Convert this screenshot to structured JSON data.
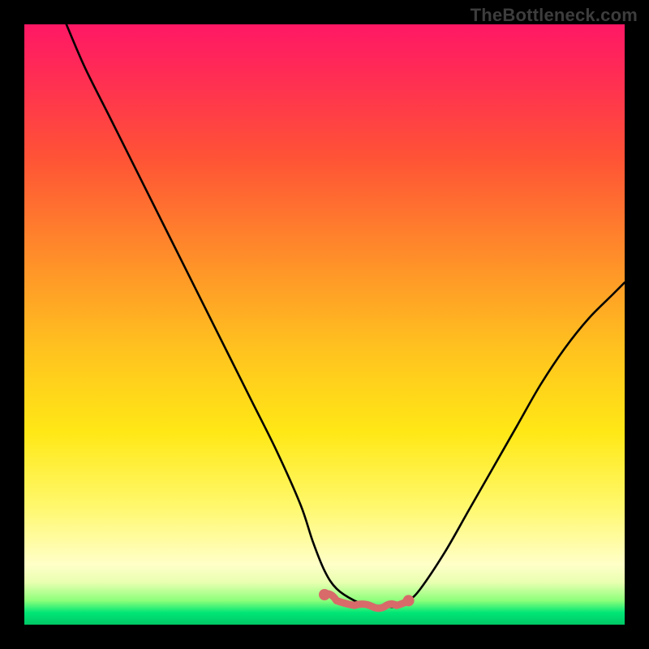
{
  "watermark": "TheBottleneck.com",
  "colors": {
    "frame_background": "#000000",
    "curve_stroke": "#000000",
    "marker_stroke": "#d86a6a",
    "marker_fill": "#d86a6a",
    "gradient_top": "#ff1865",
    "gradient_bottom": "#00c866"
  },
  "chart_data": {
    "type": "line",
    "title": "",
    "xlabel": "",
    "ylabel": "",
    "xlim": [
      0,
      100
    ],
    "ylim": [
      0,
      100
    ],
    "series": [
      {
        "name": "bottleneck-curve",
        "x": [
          7,
          10,
          14,
          18,
          22,
          26,
          30,
          34,
          38,
          42,
          46,
          48,
          50,
          52,
          55,
          58,
          60,
          62,
          64,
          66,
          70,
          74,
          78,
          82,
          86,
          90,
          94,
          98,
          100
        ],
        "y": [
          100,
          93,
          85,
          77,
          69,
          61,
          53,
          45,
          37,
          29,
          20,
          14,
          9,
          6,
          4,
          3,
          3,
          3,
          4,
          6,
          12,
          19,
          26,
          33,
          40,
          46,
          51,
          55,
          57
        ]
      }
    ],
    "marker_region": {
      "name": "optimal-zone",
      "x": [
        50,
        52,
        55,
        58,
        60,
        62,
        64
      ],
      "y": [
        5,
        4,
        3.2,
        3,
        3,
        3.2,
        4
      ]
    }
  }
}
